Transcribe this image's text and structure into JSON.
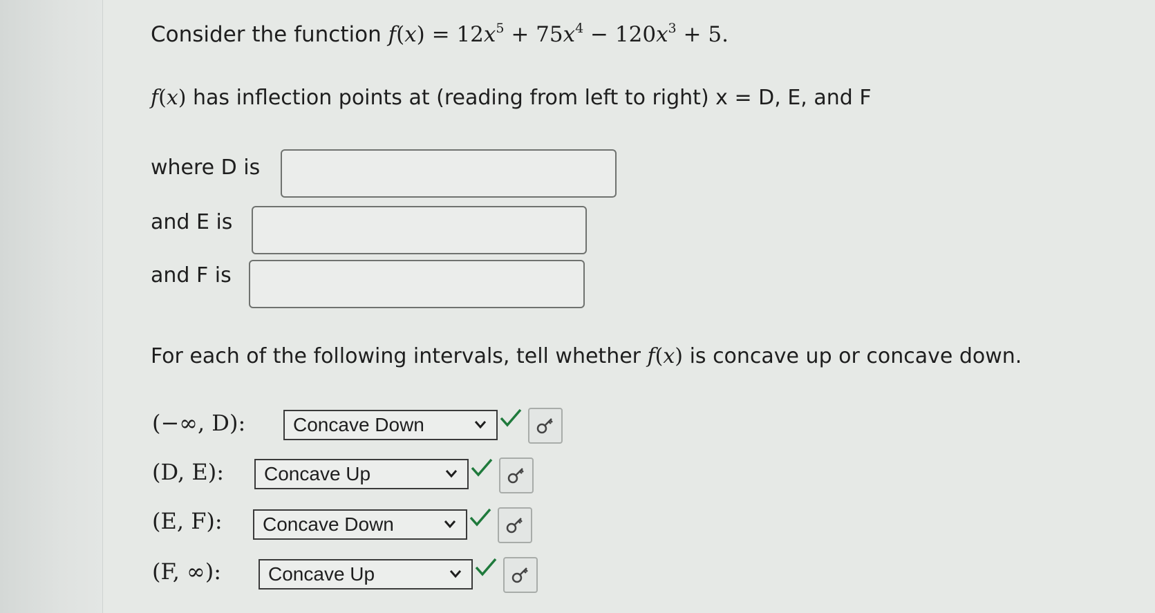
{
  "question": {
    "intro_prefix": "Consider the function",
    "fn_name": "f",
    "fn_var": "x",
    "c1": "12",
    "e1": "5",
    "c2": "75",
    "e2": "4",
    "c3": "120",
    "e3": "3",
    "c4": "5",
    "inflection_text": "has inflection points at (reading from left to right) x = D, E, and F",
    "labels": {
      "d_label": "where D is",
      "e_label": "and E is",
      "f_label": "and F is"
    },
    "inputs": {
      "d_value": "",
      "e_value": "",
      "f_value": ""
    },
    "concavity_prefix": "For each of the following intervals, tell whether",
    "concavity_suffix": "is concave up or concave down."
  },
  "intervals": [
    {
      "label": "(−∞, D):",
      "selected": "Concave Down"
    },
    {
      "label": "(D, E):",
      "selected": "Concave Up"
    },
    {
      "label": "(E, F):",
      "selected": "Concave Down"
    },
    {
      "label": "(F, ∞):",
      "selected": "Concave Up"
    }
  ],
  "colors": {
    "check": "#1f7a3c",
    "border": "#6f726f"
  },
  "icons": {
    "dropdown": "chevron-down-icon",
    "correct": "checkmark-icon",
    "help": "key-icon"
  }
}
